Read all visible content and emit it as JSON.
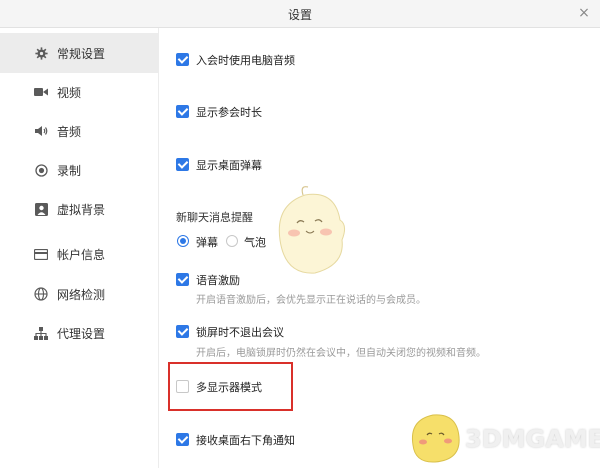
{
  "window": {
    "title": "设置",
    "close_glyph": "×"
  },
  "sidebar": {
    "items": [
      {
        "label": "常规设置",
        "icon": "gear-icon",
        "active": true
      },
      {
        "label": "视频",
        "icon": "video-icon"
      },
      {
        "label": "音频",
        "icon": "speaker-icon"
      },
      {
        "label": "录制",
        "icon": "record-icon"
      },
      {
        "label": "虚拟背景",
        "icon": "person-portrait-icon"
      },
      {
        "label": "帐户信息",
        "icon": "card-icon"
      },
      {
        "label": "网络检测",
        "icon": "globe-icon"
      },
      {
        "label": "代理设置",
        "icon": "network-tree-icon"
      }
    ]
  },
  "main": {
    "options": [
      {
        "label": "入会时使用电脑音频",
        "checked": true
      },
      {
        "label": "显示参会时长",
        "checked": true
      },
      {
        "label": "显示桌面弹幕",
        "checked": true
      },
      {
        "label": "语音激励",
        "checked": true,
        "sub": "开启语音激励后，会优先显示正在说话的与会成员。"
      },
      {
        "label": "锁屏时不退出会议",
        "checked": true,
        "sub": "开启后，电脑锁屏时仍然在会议中，但自动关闭您的视频和音频。"
      },
      {
        "label": "多显示器模式",
        "checked": false
      },
      {
        "label": "接收桌面右下角通知",
        "checked": true
      }
    ],
    "chat_reminder": {
      "title": "新聊天消息提醒",
      "radios": [
        {
          "label": "弹幕",
          "selected": true
        },
        {
          "label": "气泡",
          "selected": false
        }
      ]
    }
  },
  "watermark": {
    "text": "3DMGAME"
  },
  "colors": {
    "accent": "#2d78e6",
    "highlight": "#d9302a",
    "sidebar_active": "#ececec"
  }
}
